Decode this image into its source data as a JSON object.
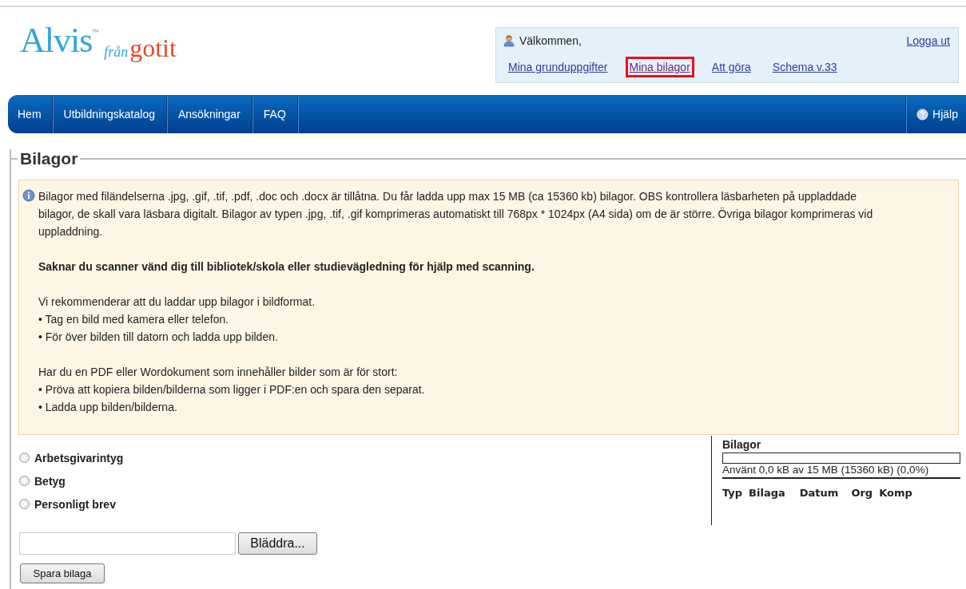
{
  "logo": {
    "name": "Alvis",
    "trademark": "™",
    "from": "från",
    "brand": "gotit"
  },
  "user_box": {
    "greeting": "Välkommen,",
    "logout": "Logga ut",
    "links": [
      {
        "label": "Mina grunduppgifter",
        "highlighted": false
      },
      {
        "label": "Mina bilagor",
        "highlighted": true
      },
      {
        "label": "Att göra",
        "highlighted": false
      },
      {
        "label": "Schema v.33",
        "highlighted": false
      }
    ]
  },
  "nav": {
    "items": [
      "Hem",
      "Utbildningskatalog",
      "Ansökningar",
      "FAQ"
    ],
    "help": "Hjälp"
  },
  "section": {
    "title": "Bilagor",
    "info": [
      {
        "kind": "text",
        "text": "Bilagor med filändelserna .jpg, .gif, .tif, .pdf, .doc och .docx är tillåtna. Du får ladda upp max 15 MB (ca 15360 kb) bilagor. OBS kontrollera läsbarheten på uppladdade bilagor, de skall vara läsbara digitalt. Bilagor av typen .jpg, .tif, .gif komprimeras automatiskt till 768px * 1024px (A4 sida) om de är större. Övriga bilagor komprimeras vid uppladdning."
      },
      {
        "kind": "bold",
        "text": "Saknar du scanner vänd dig till bibliotek/skola eller studievägledning för hjälp med scanning."
      },
      {
        "kind": "lines",
        "lines": [
          "Vi rekommenderar att du laddar upp bilagor i bildformat.",
          "• Tag en bild med kamera eller telefon.",
          "• För över bilden till datorn och ladda upp bilden."
        ]
      },
      {
        "kind": "lines",
        "lines": [
          "Har du en PDF eller Wordokument som innehåller bilder som är för stort:",
          "• Pröva att kopiera bilden/bilderna som ligger i PDF:en och spara den separat.",
          "• Ladda upp bilden/bilderna."
        ]
      }
    ],
    "types": [
      {
        "label": "Arbetsgivarintyg",
        "selected": false
      },
      {
        "label": "Betyg",
        "selected": false
      },
      {
        "label": "Personligt brev",
        "selected": false
      }
    ],
    "browse_button": "Bläddra...",
    "save_button": "Spara bilaga",
    "summary": {
      "title": "Bilagor",
      "level": 0,
      "usage": "Använt 0,0 kB av 15 MB (15360 kB) (0,0%)",
      "columns": [
        "Typ",
        "Bilaga",
        "Datum",
        "Org",
        "Komp"
      ]
    }
  }
}
